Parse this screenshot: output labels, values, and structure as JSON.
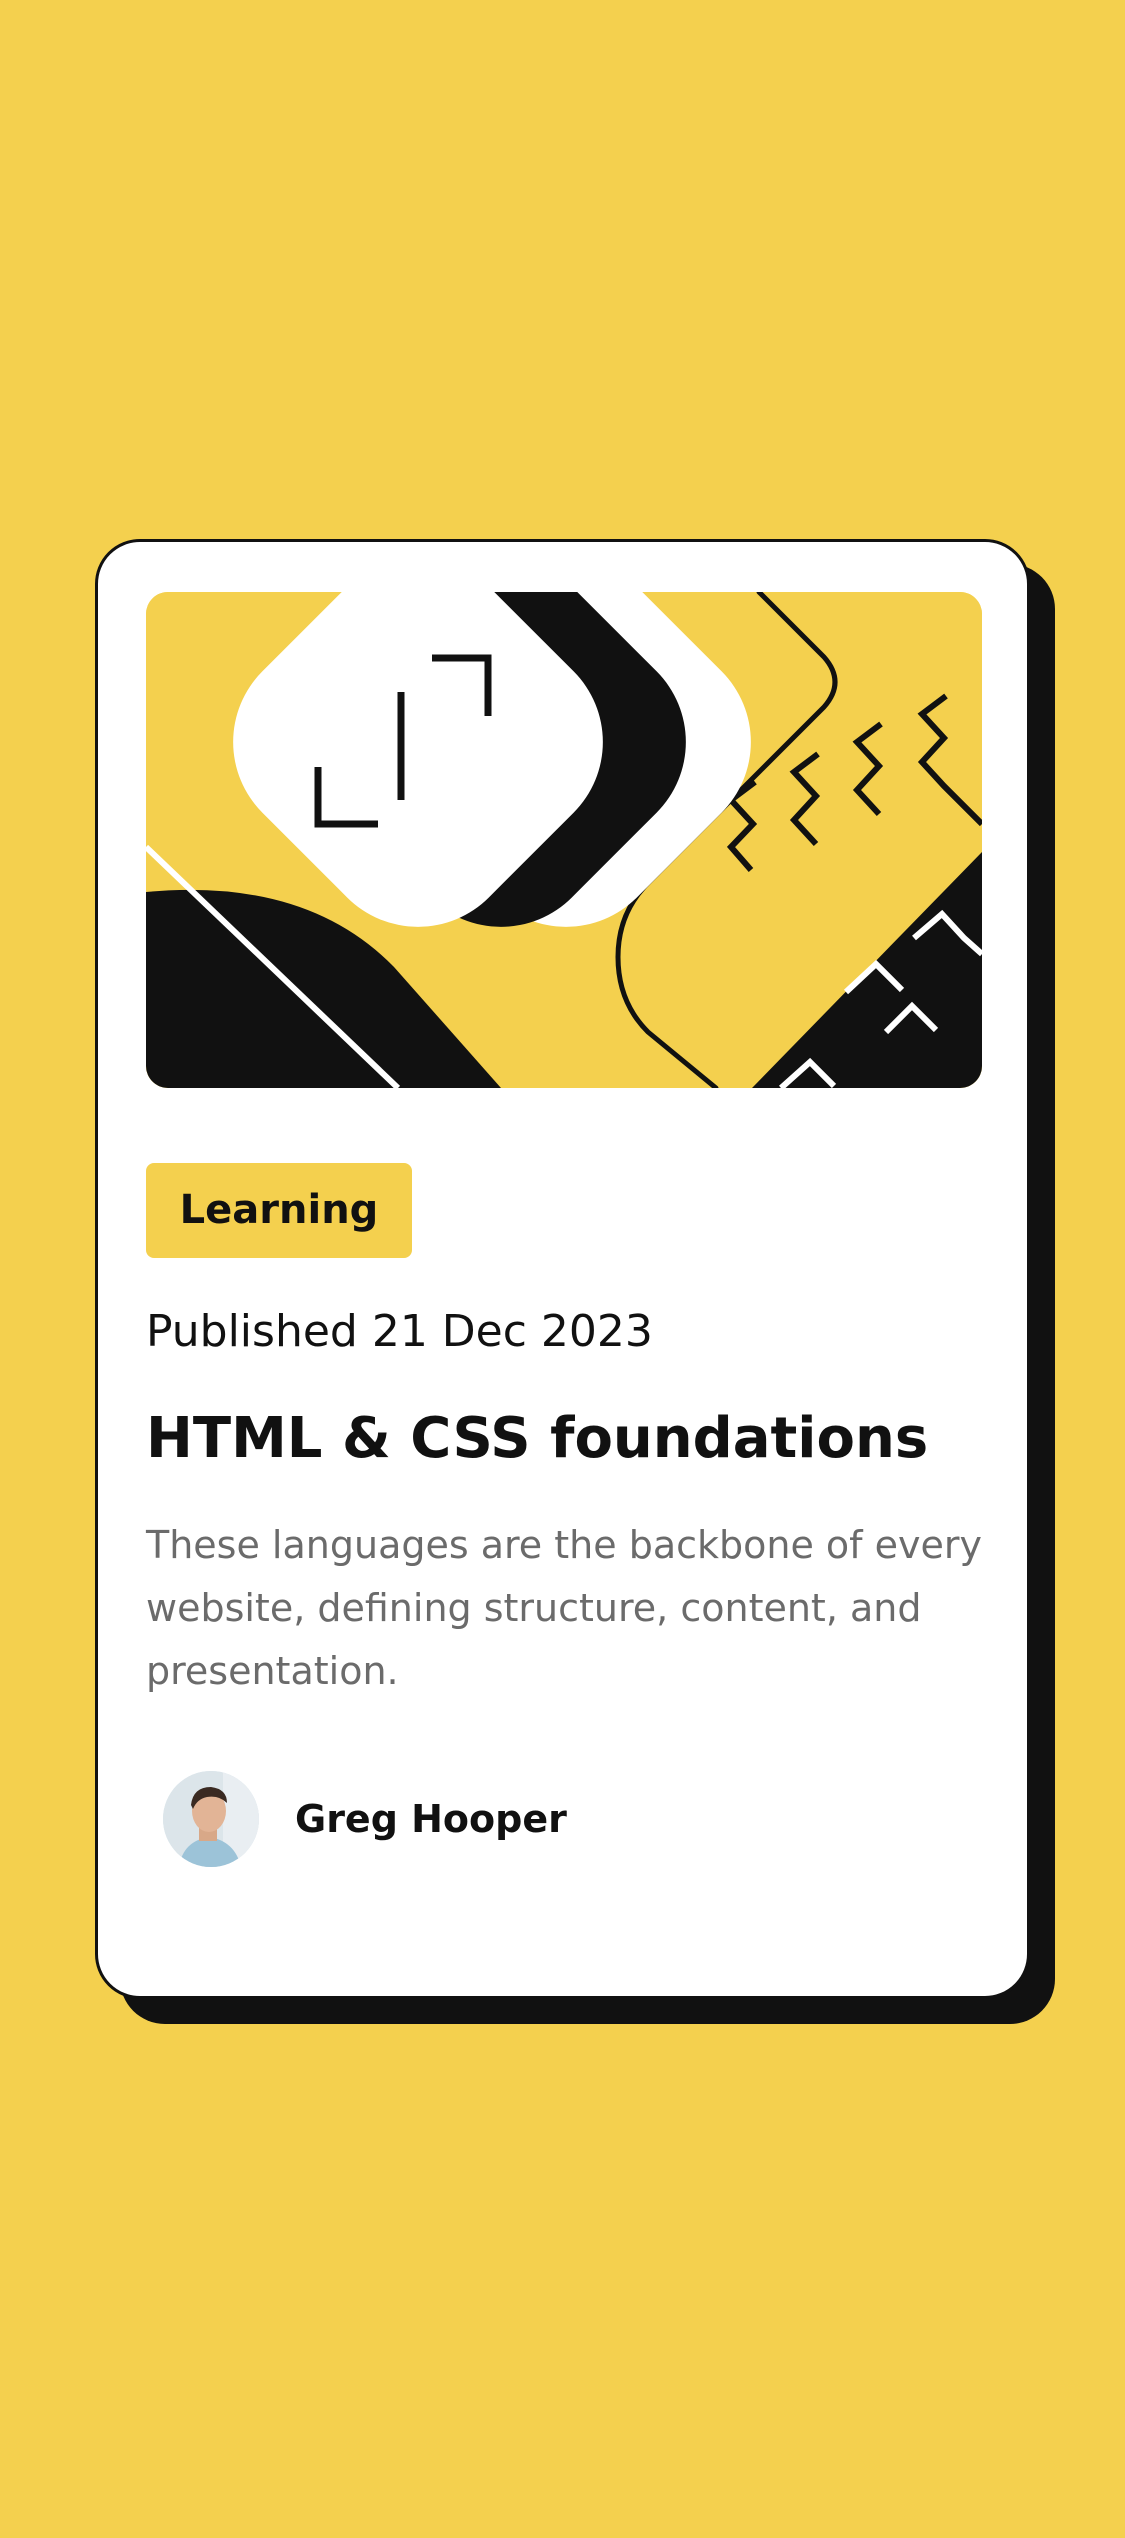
{
  "colors": {
    "background": "#F4D04E",
    "card": "#FFFFFF",
    "ink": "#111111",
    "muted_text": "#6B6B6B"
  },
  "card": {
    "tag_label": "Learning",
    "published": "Published 21 Dec 2023",
    "title": "HTML & CSS foundations",
    "description": "These languages are the backbone of every website, defining structure, content, and presentation.",
    "author_name": "Greg Hooper"
  },
  "icons": {
    "hero": "abstract-geometric-illustration",
    "avatar": "author-portrait"
  }
}
